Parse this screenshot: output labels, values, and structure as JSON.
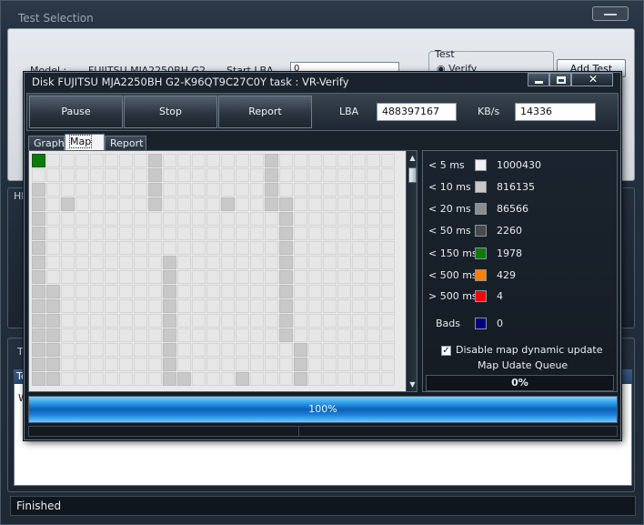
{
  "main": {
    "title": "Test Selection",
    "model_label": "Model :",
    "model_value": "FUJITSU MJA2250BH G2",
    "start_lba_label": "Start LBA",
    "start_lba_value": "0",
    "test_group_label": "Test",
    "verify_option": "Verify",
    "add_test_button": "Add Test",
    "side_label_1": "HI",
    "side_label_2": "T",
    "list_header": "Te",
    "list_row": "W",
    "status": "Finished"
  },
  "dialog": {
    "title": "Disk FUJITSU MJA2250BH G2-K96QT9C27C0Y   task : VR-Verify",
    "buttons": {
      "pause": "Pause",
      "stop": "Stop",
      "report": "Report"
    },
    "lba_label": "LBA",
    "lba_value": "488397167",
    "kbs_label": "KB/s",
    "kbs_value": "14336",
    "tabs": [
      "Graph",
      "Map",
      "Report"
    ],
    "active_tab": "Map",
    "legend": [
      {
        "label": "< 5 ms",
        "value": "1000430",
        "color": "#f0f0f0"
      },
      {
        "label": "< 10 ms",
        "value": "816135",
        "color": "#c8c8c8"
      },
      {
        "label": "< 20 ms",
        "value": "86566",
        "color": "#8c8c8c"
      },
      {
        "label": "< 50 ms",
        "value": "2260",
        "color": "#4a4a4a"
      },
      {
        "label": "< 150 ms",
        "value": "1978",
        "color": "#0d7a0d"
      },
      {
        "label": "< 500 ms",
        "value": "429",
        "color": "#ff8000"
      },
      {
        "label": "> 500 ms",
        "value": "4",
        "color": "#ff0000"
      }
    ],
    "bads": {
      "label": "Bads",
      "value": "0",
      "color": "#000080"
    },
    "disable_update_label": "Disable map dynamic update",
    "disable_update_checked": true,
    "queue_label": "Map Udate Queue",
    "queue_value": "0%",
    "progress_text": "100%",
    "progress_value": 1.0,
    "map_columns": 25,
    "map_rows": 16,
    "map_cells_10ms": [
      [
        8,
        0
      ],
      [
        16,
        0
      ],
      [
        8,
        1
      ],
      [
        16,
        1
      ],
      [
        0,
        2
      ],
      [
        8,
        2
      ],
      [
        16,
        2
      ],
      [
        0,
        3
      ],
      [
        2,
        3
      ],
      [
        8,
        3
      ],
      [
        13,
        3
      ],
      [
        16,
        3
      ],
      [
        17,
        3
      ],
      [
        0,
        4
      ],
      [
        17,
        4
      ],
      [
        0,
        5
      ],
      [
        17,
        5
      ],
      [
        0,
        6
      ],
      [
        17,
        6
      ],
      [
        0,
        7
      ],
      [
        9,
        7
      ],
      [
        17,
        7
      ],
      [
        0,
        8
      ],
      [
        9,
        8
      ],
      [
        17,
        8
      ],
      [
        0,
        9
      ],
      [
        1,
        9
      ],
      [
        9,
        9
      ],
      [
        17,
        9
      ],
      [
        0,
        10
      ],
      [
        1,
        10
      ],
      [
        9,
        10
      ],
      [
        17,
        10
      ],
      [
        0,
        11
      ],
      [
        1,
        11
      ],
      [
        9,
        11
      ],
      [
        17,
        11
      ],
      [
        0,
        12
      ],
      [
        1,
        12
      ],
      [
        9,
        12
      ],
      [
        17,
        12
      ],
      [
        0,
        13
      ],
      [
        1,
        13
      ],
      [
        9,
        13
      ],
      [
        18,
        13
      ],
      [
        0,
        14
      ],
      [
        1,
        14
      ],
      [
        9,
        14
      ],
      [
        18,
        14
      ],
      [
        0,
        15
      ],
      [
        1,
        15
      ],
      [
        9,
        15
      ],
      [
        18,
        15
      ]
    ],
    "map_cells_10ms_extra": [
      [
        1,
        12
      ],
      [
        1,
        13
      ],
      [
        1,
        14
      ],
      [
        1,
        15
      ],
      [
        9,
        11
      ],
      [
        14,
        15
      ],
      [
        10,
        15
      ],
      [
        18,
        13
      ],
      [
        18,
        14
      ],
      [
        18,
        15
      ]
    ],
    "map_cells_150ms": [
      [
        0,
        0
      ]
    ]
  }
}
